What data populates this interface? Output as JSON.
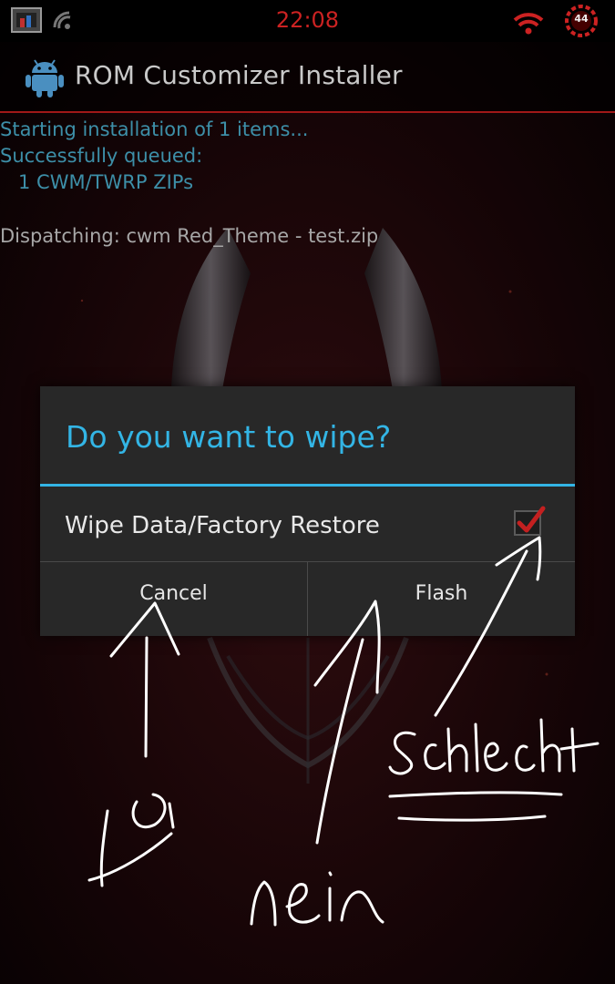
{
  "status_bar": {
    "time": "22:08",
    "battery_level": "44",
    "icons": [
      "gallery-notification-icon",
      "network-notification-icon",
      "wifi-icon",
      "battery-icon"
    ],
    "accent_color": "#cc2222"
  },
  "app_bar": {
    "title": "ROM Customizer Installer",
    "icon": "android-icon"
  },
  "log": {
    "lines": [
      "Starting installation of 1 items...",
      "Successfully queued:",
      "   1 CWM/TWRP ZIPs"
    ],
    "dispatch": "Dispatching: cwm Red_Theme - test.zip"
  },
  "dialog": {
    "title": "Do you want to wipe?",
    "option_label": "Wipe Data/Factory Restore",
    "option_checked": true,
    "cancel_label": "Cancel",
    "flash_label": "Flash",
    "accent_color": "#33b5e5"
  },
  "annotations": {
    "handwritten": [
      "ja",
      "nein",
      "Schlecht"
    ]
  }
}
